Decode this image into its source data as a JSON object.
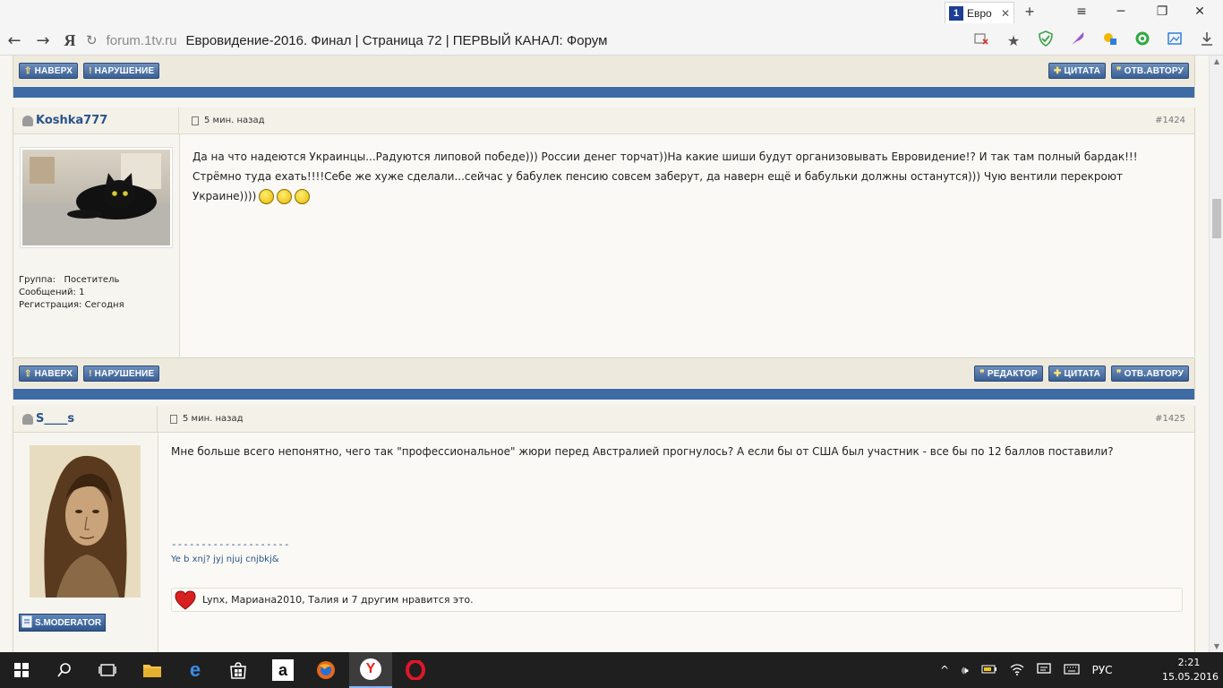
{
  "browser": {
    "tab_title": "Евро",
    "tab_favicon_letter": "1",
    "back_icon": "←",
    "forward_icon": "→",
    "yandex_label": "Я",
    "refresh_icon": "↻",
    "url_host": "forum.1tv.ru",
    "page_title": "Евровидение-2016. Финал | Страница 72 | ПЕРВЫЙ КАНАЛ: Форум",
    "new_tab_icon": "+",
    "menu_icon": "≡",
    "minimize_icon": "─",
    "maximize_icon": "❐",
    "close_icon": "✕"
  },
  "post_actions": {
    "top_label": "НАВЕРХ",
    "report_label": "НАРУШЕНИЕ",
    "edit_label": "РЕДАКТОР",
    "quote_label": "ЦИТАТА",
    "reply_label": "ОТВ.АВТОРУ"
  },
  "posts": [
    {
      "author": "Koshka777",
      "date": "5 мин. назад",
      "number": "#1424",
      "text": "Да на что надеются Украинцы...Радуются липовой победе))) России денег торчат))На какие шиши будут организовывать Евровидение!? И так там полный бардак!!!Стрёмно туда ехать!!!!Себе же хуже сделали...сейчас у бабулек пенсию совсем заберут, да наверн ещё и бабульки должны останутся))) Чую вентили перекроют Украине))))",
      "group_label": "Группа:",
      "group_value": "Посетитель",
      "messages_label": "Сообщений:",
      "messages_value": "1",
      "reg_label": "Регистрация:",
      "reg_value": "Сегодня"
    },
    {
      "author": "S____s",
      "date": "5 мин. назад",
      "number": "#1425",
      "text": "Мне больше всего непонятно, чего так \"профессиональное\" жюри перед Австралией прогнулось? А если бы от США был участник - все бы по 12 баллов поставили?",
      "signature_divider": "--------------------",
      "signature": "Ye b xnj? jyj njuj cnjbkj&",
      "likes": "Lynx, Мариана2010, Талия и 7 другим нравится это.",
      "badge": "S.MODERATOR"
    }
  ],
  "taskbar": {
    "lang": "РУС",
    "time": "2:21",
    "date": "15.05.2016"
  },
  "colors": {
    "accent_blue": "#3e6ba3",
    "link_blue": "#2a5389",
    "forum_bg": "#f6f5f0"
  }
}
